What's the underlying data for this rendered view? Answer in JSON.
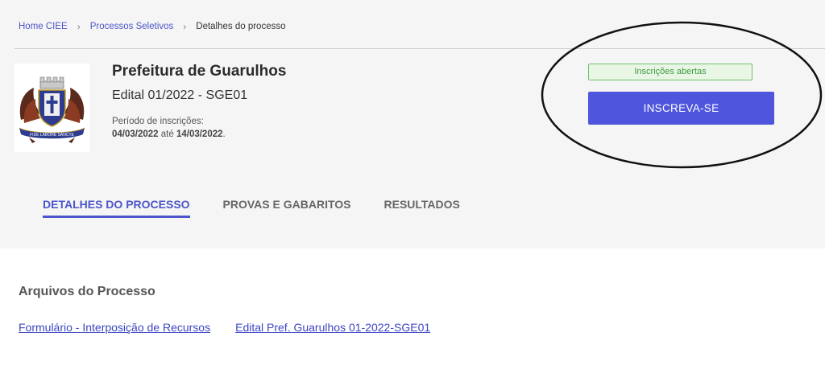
{
  "breadcrumb": {
    "items": [
      "Home CIEE",
      "Processos Seletivos"
    ],
    "current": "Detalhes do processo",
    "separator": "›"
  },
  "process": {
    "organization": "Prefeitura de Guarulhos",
    "edital": "Edital 01/2022 - SGE01",
    "period_label": "Período de inscrições:",
    "period_start": "04/03/2022",
    "period_connector": " até ",
    "period_end": "14/03/2022",
    "period_end_punct": "."
  },
  "logo": {
    "icon": "guarulhos-coat-of-arms-icon",
    "motto": "FIDE LABORE SANCTE"
  },
  "status": {
    "badge": "Inscrições abertas",
    "badge_color": "#3e9b3e"
  },
  "actions": {
    "subscribe_label": "INSCREVA-SE",
    "accent_color": "#4f55dc"
  },
  "tabs": [
    {
      "label": "DETALHES DO PROCESSO",
      "active": true
    },
    {
      "label": "PROVAS E GABARITOS",
      "active": false
    },
    {
      "label": "RESULTADOS",
      "active": false
    }
  ],
  "files": {
    "title": "Arquivos do Processo",
    "links": [
      "Formulário - Interposição de Recursos",
      "Edital Pref. Guarulhos 01-2022-SGE01"
    ]
  }
}
